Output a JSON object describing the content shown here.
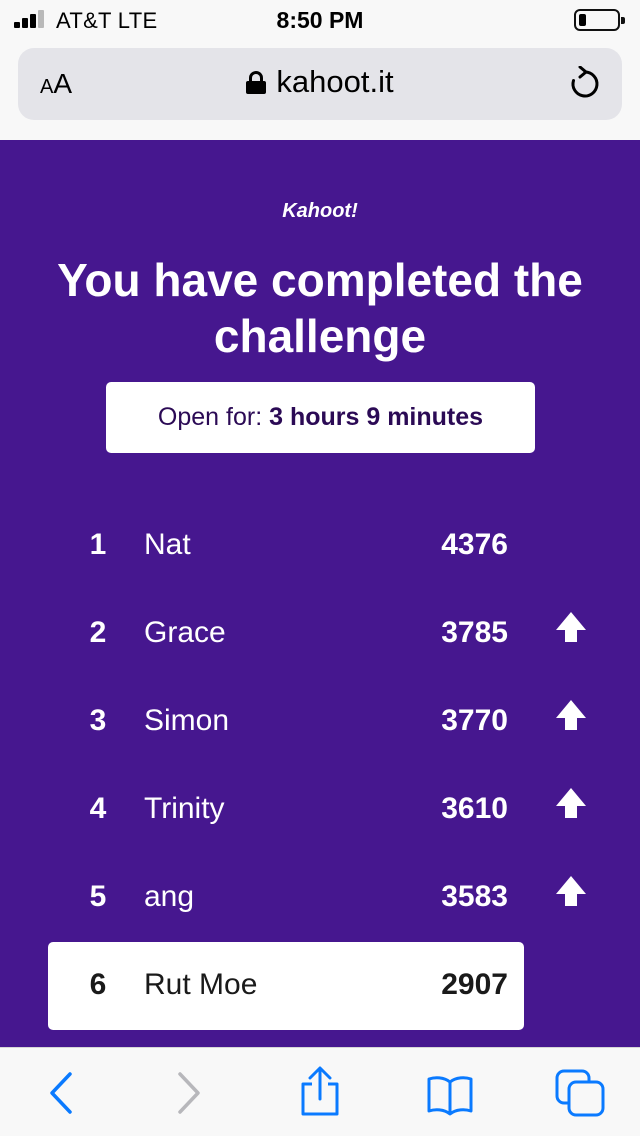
{
  "status_bar": {
    "carrier": "AT&T  LTE",
    "time": "8:50 PM"
  },
  "browser": {
    "text_size_label_small": "A",
    "text_size_label_large": "A",
    "url": "kahoot.it"
  },
  "page": {
    "logo": "Kahoot!",
    "headline": "You have completed the challenge",
    "open_for_label": "Open for:",
    "open_for_value": "3 hours 9 minutes"
  },
  "leaderboard": [
    {
      "rank": "1",
      "name": "Nat",
      "score": "4376",
      "trend_icon": ""
    },
    {
      "rank": "2",
      "name": "Grace",
      "score": "3785",
      "trend_icon": "arrow-up-icon"
    },
    {
      "rank": "3",
      "name": "Simon",
      "score": "3770",
      "trend_icon": "arrow-up-icon"
    },
    {
      "rank": "4",
      "name": "Trinity",
      "score": "3610",
      "trend_icon": "arrow-up-icon"
    },
    {
      "rank": "5",
      "name": "ang",
      "score": "3583",
      "trend_icon": "arrow-up-icon"
    },
    {
      "rank": "6",
      "name": "Rut Moe",
      "score": "2907",
      "trend_icon": ""
    }
  ],
  "colors": {
    "brand_purple": "#46178f",
    "ios_blue": "#0a7aff"
  },
  "toolbar_icons": [
    "back-icon",
    "forward-icon",
    "share-icon",
    "bookmarks-icon",
    "tabs-icon"
  ]
}
